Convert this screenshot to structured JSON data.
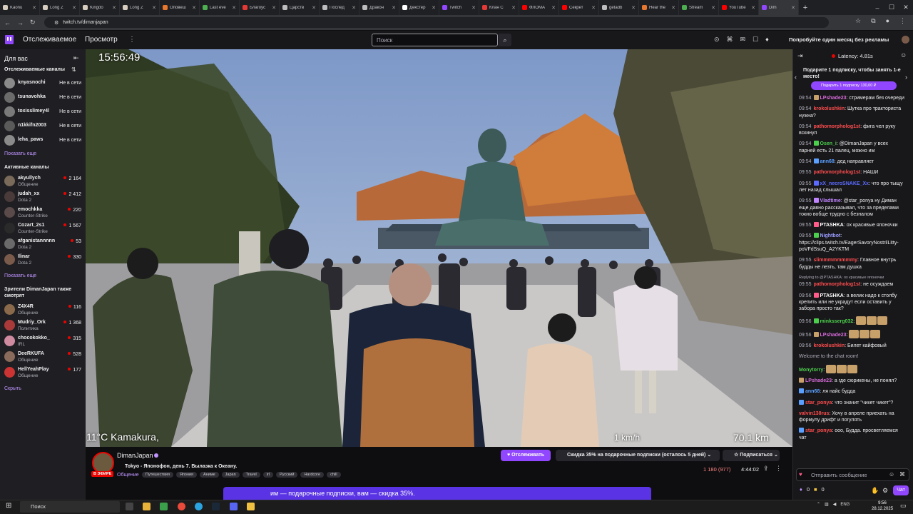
{
  "browser": {
    "tabs": [
      {
        "label": "Kaonu",
        "color": "#d6cdbf"
      },
      {
        "label": "Long Z",
        "color": "#d6cdbf"
      },
      {
        "label": "Kingdo",
        "color": "#d6cdbf"
      },
      {
        "label": "Long Z",
        "color": "#d6cdbf"
      },
      {
        "label": "Оповеш",
        "color": "#e8772e"
      },
      {
        "label": "Last eve",
        "color": "#4caf50"
      },
      {
        "label": "Благоус",
        "color": "#e53935"
      },
      {
        "label": "Царств",
        "color": "#bdbdbd"
      },
      {
        "label": "Послед",
        "color": "#bdbdbd"
      },
      {
        "label": "Дракон",
        "color": "#bdbdbd"
      },
      {
        "label": "Декстер",
        "color": "#ffffff"
      },
      {
        "label": "Twitch",
        "color": "#9147ff"
      },
      {
        "label": "Клан С",
        "color": "#e53935"
      },
      {
        "label": "ФЛОМА",
        "color": "#ff0000"
      },
      {
        "label": "Секрет",
        "color": "#ff0000"
      },
      {
        "label": "getadb",
        "color": "#bdbdbd"
      },
      {
        "label": "Hear the",
        "color": "#e8772e"
      },
      {
        "label": "Stream",
        "color": "#4caf50"
      },
      {
        "label": "YouTube",
        "color": "#ff0000"
      },
      {
        "label": "Dim",
        "color": "#9147ff",
        "active": true
      }
    ],
    "url": "twitch.tv/dimanjapan"
  },
  "nav": {
    "following": "Отслеживаемое",
    "browse": "Просмотр",
    "search_placeholder": "Поиск",
    "prime": "Попробуйте один месяц без рекламы"
  },
  "sidebar": {
    "title": "Для вас",
    "followed_title": "Отслеживаемые каналы",
    "offline": [
      {
        "name": "knyasnochi",
        "status": "Не в сети",
        "color": "#8a8a8a"
      },
      {
        "name": "tsunavohka",
        "status": "Не в сети",
        "color": "#6b6b6b"
      },
      {
        "name": "toxisslimey4l",
        "status": "Не в сети",
        "color": "#7a7a7a"
      },
      {
        "name": "n1kkifn2003",
        "status": "Не в сети",
        "color": "#5a5a5a"
      },
      {
        "name": "leha_paws",
        "status": "Не в сети",
        "color": "#8a8a8a"
      }
    ],
    "show_more": "Показать еще",
    "active_title": "Активные каналы",
    "active": [
      {
        "name": "akyullych",
        "game": "Общение",
        "viewers": "2 164",
        "color": "#7a6a5a"
      },
      {
        "name": "judah_xx",
        "game": "Dota 2",
        "viewers": "2 412",
        "color": "#4a3a3a"
      },
      {
        "name": "emochkka",
        "game": "Counter-Strike",
        "viewers": "220",
        "color": "#5a4a4a"
      },
      {
        "name": "Cozart_2s1",
        "game": "Counter-Strike",
        "viewers": "1 567",
        "color": "#2a2a2a"
      },
      {
        "name": "afganistannnnn",
        "game": "Dota 2",
        "viewers": "53",
        "color": "#6a6a6a"
      },
      {
        "name": "Ilinar",
        "game": "Dota 2",
        "viewers": "330",
        "color": "#7a5a4a"
      }
    ],
    "show_more2": "Показать еще",
    "also_title_1": "Зрители DimanJapan также",
    "also_title_2": "смотрят",
    "also": [
      {
        "name": "Z4X4R",
        "game": "Общение",
        "viewers": "116",
        "color": "#8a6a4a"
      },
      {
        "name": "Mudriy_Ork",
        "game": "Политика",
        "viewers": "1 368",
        "color": "#aa3a3a"
      },
      {
        "name": "chocokokko_",
        "game": "IRL",
        "viewers": "315",
        "color": "#d08aa0"
      },
      {
        "name": "DeeRKUFA",
        "game": "Общение",
        "viewers": "528",
        "color": "#8a6a5a"
      },
      {
        "name": "HellYeahPlay",
        "game": "Общение",
        "viewers": "177",
        "color": "#cc3333"
      }
    ],
    "hide": "Скрыть"
  },
  "video": {
    "time": "15:56:49",
    "temp": "11°C  Kamakura,",
    "speed": "1 km/h",
    "distance": "70.1 km"
  },
  "channel": {
    "name": "DimanJapan",
    "live": "В ЭФИРЕ",
    "title": "Tokyo - Японофон, день 7. Вылазка к Океану.",
    "category": "Общение",
    "tags": [
      "Путешествия",
      "Япония",
      "Аниме",
      "Japan",
      "Travel",
      "irl",
      "Русский",
      "Hardcore",
      "chill"
    ],
    "follow": "Отслеживать",
    "gift_offer": "Скидка 35% на подарочные подписки (осталось 5 дней)",
    "subscribe": "Подписаться",
    "viewers": "1 180 (977)",
    "uptime": "4:44:02",
    "promo": "им — подарочные подписки, вам — скидка 35%."
  },
  "chat": {
    "latency": "Latency: 4.81s",
    "gift_promo": "Подарите 1 подписку, чтобы занять 1-е место!",
    "gift_button": "Подарить 1 подписку   130,00 ₽",
    "messages": [
      {
        "t": "09:54",
        "u": "LPshade23",
        "c": "#d86bd8",
        "m": "стримерам без очереди",
        "b": "#c8a06a"
      },
      {
        "t": "09:54",
        "u": "krokolushkin",
        "c": "#ff4d4d",
        "m": "Шутка про тракториста нужна?"
      },
      {
        "t": "09:54",
        "u": "pathomorpholog1st",
        "c": "#ff4d4d",
        "m": "фига чел руку вскинул"
      },
      {
        "t": "09:54",
        "u": "Osen_i",
        "c": "#4ccf4c",
        "m": "@DimanJapan у всех парней есть 21 палец, можно им",
        "b": "#4ccf4c"
      },
      {
        "t": "09:54",
        "u": "ann68",
        "c": "#5ba0ff",
        "m": "дед направляет",
        "b": "#5ba0ff"
      },
      {
        "t": "09:55",
        "u": "pathomorpholog1st",
        "c": "#ff4d4d",
        "m": "НАШИ"
      },
      {
        "t": "09:55",
        "u": "xX_necroSNAKE_Xx",
        "c": "#5b6bff",
        "m": "что про тыщу лет назад слышал",
        "b": "#5b6bff"
      },
      {
        "t": "09:55",
        "u": "Vladtime",
        "c": "#c084ff",
        "m": "@star_ponya ну Диман еще давно рассказывал, что за пределами токио вобще трудно с безналом",
        "b": "#c084ff"
      },
      {
        "t": "09:55",
        "u": "PTASHKA",
        "c": "#ffffff",
        "m": "ох красивые японочки",
        "b": "#ff5c8a"
      },
      {
        "t": "09:55",
        "u": "Nightbot",
        "c": "#9b9bff",
        "m": "https://clips.twitch.tv/EagerSavoryNostrilLitty-poVFdSsuQ_A2YKTM",
        "b": "#4ccf4c"
      },
      {
        "t": "09:55",
        "u": "slimmmmmmmmy",
        "c": "#ff4d4d",
        "m": "Главное внутрь будды не лезть, там душка"
      },
      {
        "t": "09:55",
        "u": "pathomorpholog1st",
        "c": "#ff4d4d",
        "m": "не осуждаем",
        "reply": "Replying to @PTASHKA: ох красивые японочки"
      },
      {
        "t": "09:56",
        "u": "PTASHKA",
        "c": "#ffffff",
        "m": "а велик надо к столбу крепить или не украдут если оставить у забора просто так?",
        "b": "#ff5c8a"
      },
      {
        "t": "09:56",
        "u": "minksserg032",
        "c": "#4ccf4c",
        "m": "",
        "b": "#4ccf4c",
        "emotes": 3
      },
      {
        "t": "09:56",
        "u": "LPshade23",
        "c": "#d86bd8",
        "m": "",
        "b": "#c8a06a",
        "emotes": 3
      },
      {
        "t": "09:56",
        "u": "krokolushkin",
        "c": "#ff4d4d",
        "m": "Билет кайфовый"
      },
      {
        "t": "",
        "u": "",
        "c": "#adadb8",
        "m": "Welcome to the chat room!",
        "system": true
      },
      {
        "t": "",
        "u": "Monytorry",
        "c": "#4ccf4c",
        "m": "",
        "emotes": 3
      },
      {
        "t": "",
        "u": "LPshade23",
        "c": "#d86bd8",
        "m": "а где сюрикены, не понял?",
        "b": "#c8a06a"
      },
      {
        "t": "",
        "u": "ann68",
        "c": "#5ba0ff",
        "m": "ля найс будда",
        "b": "#5ba0ff"
      },
      {
        "t": "",
        "u": "star_ponya",
        "c": "#ff4d4d",
        "m": "что значит \"чикет чикет\"?",
        "b": "#5ba0ff"
      },
      {
        "t": "",
        "u": "valvin138rus",
        "c": "#ff4d4d",
        "m": "Хочу в апреле приехать на формулу дрифт и погулять"
      },
      {
        "t": "",
        "u": "star_ponya",
        "c": "#ff4d4d",
        "m": "ооо, Будда. просветляемся чат",
        "b": "#5ba0ff"
      }
    ],
    "input_placeholder": "Отправить сообщение",
    "points1": "0",
    "points2": "0",
    "chat_button": "Чат"
  },
  "taskbar": {
    "search": "Поиск",
    "lang": "ENG",
    "time": "9:56",
    "date": "28.12.2025"
  }
}
